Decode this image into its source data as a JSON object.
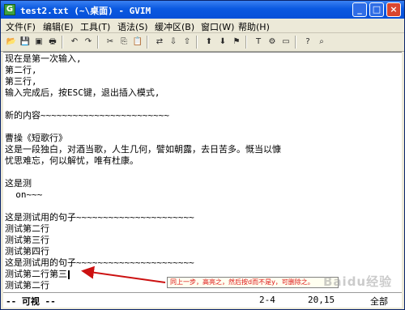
{
  "window": {
    "title": "test2.txt (~\\桌面) - GVIM",
    "app_icon_glyph": "G",
    "buttons": {
      "min": "_",
      "max": "□",
      "close": "×"
    }
  },
  "menubar": {
    "items": [
      "文件(F)",
      "编辑(E)",
      "工具(T)",
      "语法(S)",
      "缓冲区(B)",
      "窗口(W)",
      "帮助(H)"
    ]
  },
  "toolbar": {
    "buttons": [
      {
        "icon": "open-icon",
        "glyph": "📂"
      },
      {
        "icon": "save-icon",
        "glyph": "💾"
      },
      {
        "icon": "save-all-icon",
        "glyph": "▣"
      },
      {
        "icon": "print-icon",
        "glyph": "🖶"
      },
      {
        "icon": "undo-icon",
        "glyph": "↶"
      },
      {
        "icon": "redo-icon",
        "glyph": "↷"
      },
      {
        "icon": "cut-icon",
        "glyph": "✂"
      },
      {
        "icon": "copy-icon",
        "glyph": "⎘"
      },
      {
        "icon": "paste-icon",
        "glyph": "📋"
      },
      {
        "icon": "replace-icon",
        "glyph": "⇄"
      },
      {
        "icon": "find-next-icon",
        "glyph": "⇩"
      },
      {
        "icon": "find-prev-icon",
        "glyph": "⇧"
      },
      {
        "icon": "load-session-icon",
        "glyph": "⬆"
      },
      {
        "icon": "save-session-icon",
        "glyph": "⬇"
      },
      {
        "icon": "run-script-icon",
        "glyph": "⚑"
      },
      {
        "icon": "make-icon",
        "glyph": "T"
      },
      {
        "icon": "shell-icon",
        "glyph": "⚙"
      },
      {
        "icon": "tag-jump-icon",
        "glyph": "▭"
      },
      {
        "icon": "help-icon",
        "glyph": "?"
      },
      {
        "icon": "find-help-icon",
        "glyph": "⌕"
      }
    ]
  },
  "editor": {
    "lines": [
      "现在是第一次输入,",
      "第二行,",
      "第三行,",
      "输入完成后，按ESC键，退出插入模式,",
      "",
      "新的内容~~~~~~~~~~~~~~~~~~~~~~~~",
      "",
      "曹操《短歌行》",
      "这是一段独白，对酒当歌，人生几何，譬如朝露，去日苦多。慨当以慷",
      "忧思难忘，何以解忧，唯有杜康。",
      "",
      "这是测",
      "  on~~~",
      "",
      "这是测试用的句子~~~~~~~~~~~~~~~~~~~~~~",
      "测试第二行",
      "测试第三行",
      "测试第四行",
      "这是测试用的句子~~~~~~~~~~~~~~~~~~~~~~",
      "测试第二行第三",
      "测试第二行"
    ],
    "tilde_lines": [
      "~",
      "~",
      "~"
    ],
    "annotation": "同上一步，高亮之，然后按d而不是y，可删除之。"
  },
  "statusbar": {
    "mode": "-- 可视 --",
    "ruler": "2-4",
    "position": "20,15",
    "scroll": "全部"
  },
  "watermark": "Baidu经验",
  "colors": {
    "title_gradient_top": "#3a81f3",
    "title_gradient_bottom": "#0650d8",
    "annotation_text": "#dd1111",
    "arrow": "#cc1111",
    "tilde": "#0000c8"
  }
}
